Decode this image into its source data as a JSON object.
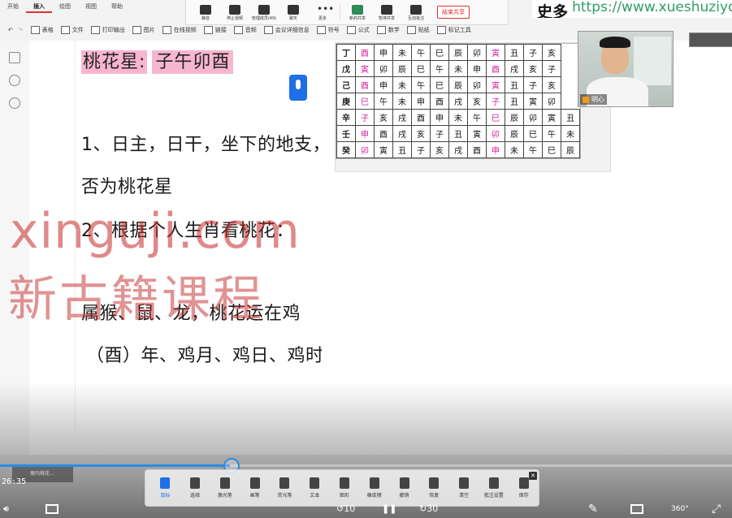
{
  "ribbon": {
    "menu": [
      "开始",
      "插入",
      "绘图",
      "视图",
      "帮助"
    ],
    "active_menu": "插入",
    "tools": [
      "表格",
      "文件",
      "打印输出",
      "图片",
      "在线视频",
      "链接",
      "音频",
      "会议详细信息",
      "符号",
      "公式",
      "数学",
      "贴纸",
      "标记工具"
    ]
  },
  "meeting": {
    "buttons": [
      "静音",
      "停止视频",
      "管理成员(49)",
      "聊天",
      "更多",
      "新的共享",
      "暂停共享",
      "互动批注"
    ],
    "end_share": "结束共享"
  },
  "banner": {
    "cjk": "史多",
    "url": "https://www.xueshuziydan.com"
  },
  "doc": {
    "peach_label": "桃花星:",
    "peach_branches": "子午卯酉",
    "line1": "1、日主，日干，坐下的地支，是",
    "line2": "否为桃花星",
    "line3": "2、根据个人生肖看桃花：",
    "line4": "属猴、鼠、龙，桃花运在鸡",
    "line5": "（酉）年、鸡月、鸡日、鸡时"
  },
  "table": {
    "rows": [
      [
        "丁",
        "酉",
        "申",
        "未",
        "午",
        "巳",
        "辰",
        "卯",
        "寅",
        "丑",
        "子",
        "亥"
      ],
      [
        "戊",
        "寅",
        "卯",
        "辰",
        "巳",
        "午",
        "未",
        "申",
        "酉",
        "戌",
        "亥",
        "子"
      ],
      [
        "己",
        "酉",
        "申",
        "未",
        "午",
        "巳",
        "辰",
        "卯",
        "寅",
        "丑",
        "子",
        "亥"
      ],
      [
        "庚",
        "巳",
        "午",
        "未",
        "申",
        "酉",
        "戌",
        "亥",
        "子",
        "丑",
        "寅",
        "卯"
      ],
      [
        "辛",
        "子",
        "亥",
        "戌",
        "酉",
        "申",
        "未",
        "午",
        "巳",
        "辰",
        "卯",
        "寅",
        "丑"
      ],
      [
        "壬",
        "申",
        "酉",
        "戌",
        "亥",
        "子",
        "丑",
        "寅",
        "卯",
        "辰",
        "巳",
        "午",
        "未"
      ],
      [
        "癸",
        "卯",
        "寅",
        "丑",
        "子",
        "亥",
        "戌",
        "酉",
        "申",
        "未",
        "午",
        "巳",
        "辰"
      ]
    ],
    "highlight_chars": [
      "酉",
      "寅",
      "巳",
      "子",
      "申",
      "卯"
    ]
  },
  "webcam": {
    "name": "明心"
  },
  "watermark": {
    "line1": "xinguji.com",
    "line2": "新古籍课程"
  },
  "player": {
    "current_time": "26:35",
    "progress": 0.314,
    "prev_thumb_label": "瘦内桃花...",
    "skip_back": "10",
    "skip_forward": "30",
    "rotate": "360"
  },
  "pen_toolbar": {
    "tools": [
      "鼠标",
      "选择",
      "激光笔",
      "画笔",
      "荧光笔",
      "文本",
      "图形",
      "橡皮擦",
      "撤销",
      "恢复",
      "清空",
      "批注设置",
      "保存"
    ],
    "active": "鼠标"
  }
}
